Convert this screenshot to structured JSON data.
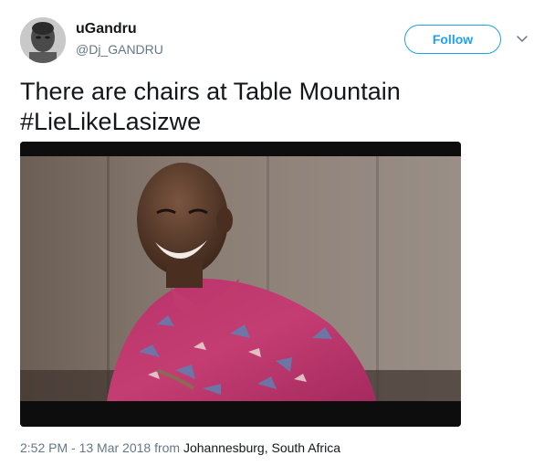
{
  "author": {
    "display_name": "uGandru",
    "handle": "@Dj_GANDRU"
  },
  "follow_button": {
    "label": "Follow",
    "color": "#1da1f2"
  },
  "tweet": {
    "text_line1": "There are chairs at Table Mountain",
    "text_line2": "#LieLikeLasizwe"
  },
  "media": {
    "icon": "video-still-image"
  },
  "meta": {
    "datetime": "2:52 PM - 13 Mar 2018",
    "from_label": "from",
    "location": "Johannesburg, South Africa"
  },
  "icons": {
    "menu": "chevron-down-icon"
  }
}
